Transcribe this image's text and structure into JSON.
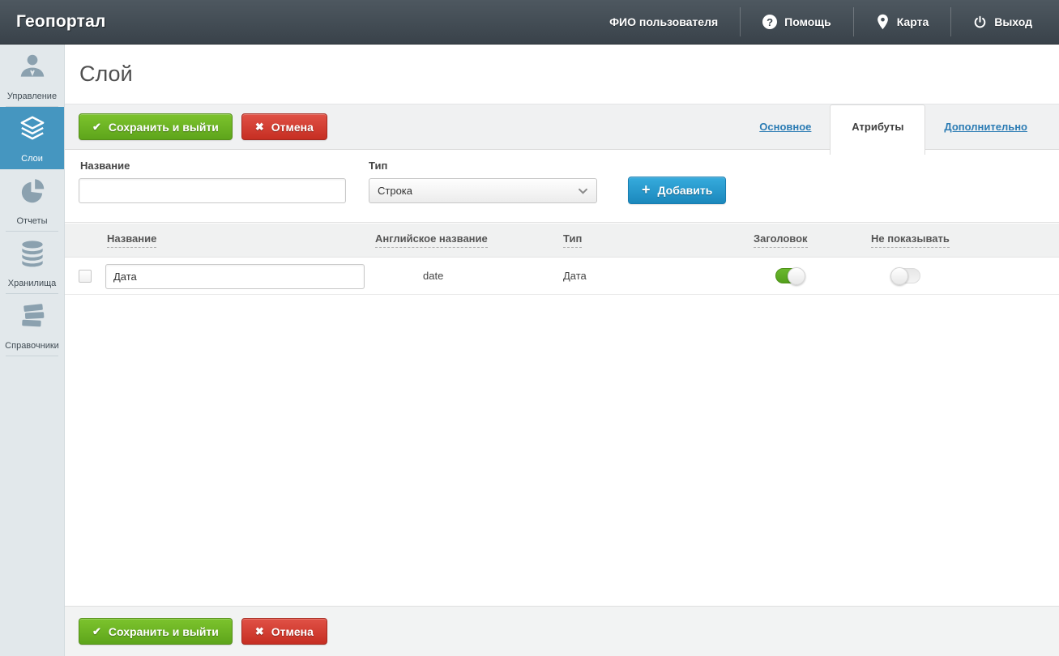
{
  "header": {
    "brand": "Геопортал",
    "user_name": "ФИО пользователя",
    "help_label": "Помощь",
    "map_label": "Карта",
    "logout_label": "Выход",
    "help_glyph": "?"
  },
  "sidebar": {
    "items": [
      {
        "label": "Управление",
        "icon": "user-icon",
        "active": false
      },
      {
        "label": "Слои",
        "icon": "layers-icon",
        "active": true
      },
      {
        "label": "Отчеты",
        "icon": "pie-chart-icon",
        "active": false
      },
      {
        "label": "Хранилища",
        "icon": "database-icon",
        "active": false
      },
      {
        "label": "Справочники",
        "icon": "books-icon",
        "active": false
      }
    ]
  },
  "page": {
    "title": "Слой"
  },
  "toolbar": {
    "save_label": "Сохранить и выйти",
    "cancel_label": "Отмена",
    "save_glyph": "✔",
    "cancel_glyph": "✖"
  },
  "tabs": {
    "main": "Основное",
    "attributes": "Атрибуты",
    "extra": "Дополнительно",
    "active_tab": "Атрибуты"
  },
  "form": {
    "name_label": "Название",
    "name_value": "",
    "type_label": "Тип",
    "type_value": "Строка",
    "add_label": "Добавить",
    "add_glyph": "+"
  },
  "table": {
    "headers": {
      "name": "Название",
      "english": "Английское название",
      "type": "Тип",
      "header": "Заголовок",
      "hide": "Не показывать"
    },
    "rows": [
      {
        "name": "Дата",
        "english": "date",
        "type": "Дата",
        "header_state": "on",
        "hide_state": "off"
      }
    ]
  },
  "colors": {
    "header_dark": "#424c54",
    "sidebar_bg": "#e2e8eb",
    "accent_blue": "#4596c0",
    "link_blue": "#2c7cb4",
    "button_green": "#6cb32a",
    "button_red": "#d23a2e",
    "button_blue": "#29a0d0",
    "toggle_on_green": "#5fad27"
  }
}
